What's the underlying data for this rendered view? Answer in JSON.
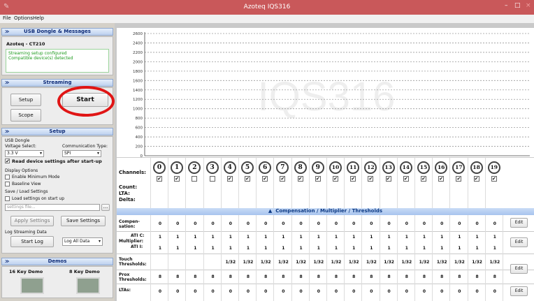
{
  "window": {
    "title": "Azoteq IQS316"
  },
  "menu": [
    "File",
    "Options",
    "Help"
  ],
  "usb_panel": {
    "header": "USB Dongle & Messages",
    "device": "Azoteq - CT210",
    "messages": [
      "Streaming setup configured",
      "Compatible device(s) detected"
    ]
  },
  "streaming_panel": {
    "header": "Streaming",
    "setup": "Setup",
    "start": "Start",
    "scope": "Scope"
  },
  "setup_panel": {
    "header": "Setup",
    "usb_dongle": "USB Dongle",
    "voltage_label": "Voltage Select:",
    "voltage_value": "3.3 V",
    "comm_label": "Communication Type:",
    "comm_value": "SPI",
    "read_settings": "Read device settings after start-up",
    "display_options": "Display Options",
    "enable_minimum": "Enable Minimum Mode",
    "baseline_view": "Baseline View",
    "save_load": "Save / Load Settings",
    "load_on_start": "Load settings on start up",
    "settings_placeholder": "settings file...",
    "browse": "...",
    "apply": "Apply Settings",
    "save": "Save Settings",
    "log_label": "Log Streaming Data",
    "start_log": "Start Log",
    "log_mode": "Log All Data"
  },
  "demos_panel": {
    "header": "Demos",
    "demo1": "16 Key Demo",
    "demo2": "8 Key Demo"
  },
  "chart_data": {
    "type": "line",
    "y_ticks": [
      "2600",
      "2400",
      "2200",
      "2000",
      "1800",
      "1600",
      "1400",
      "1200",
      "1000",
      "800",
      "600",
      "400",
      "200",
      "0"
    ],
    "ylim": [
      0,
      2600
    ],
    "watermark": "IQS316",
    "grid": "dashed horizontal"
  },
  "channels": {
    "label": "Channels:",
    "numbers": [
      "0",
      "1",
      "2",
      "3",
      "4",
      "5",
      "6",
      "7",
      "8",
      "9",
      "10",
      "11",
      "12",
      "13",
      "14",
      "15",
      "16",
      "17",
      "18",
      "19"
    ],
    "checked": [
      true,
      true,
      false,
      false,
      true,
      true,
      true,
      true,
      true,
      true,
      true,
      true,
      true,
      true,
      true,
      true,
      true,
      true,
      true,
      true
    ],
    "count_label": "Count:",
    "lta_label": "LTA:",
    "delta_label": "Delta:"
  },
  "table": {
    "banner": "Compensation / Multiplier / Thresholds",
    "edit": "Edit",
    "compensation_label": "Compen-\nsation:",
    "compensation": [
      "0",
      "0",
      "0",
      "0",
      "0",
      "0",
      "0",
      "0",
      "0",
      "0",
      "0",
      "0",
      "0",
      "0",
      "0",
      "0",
      "0",
      "0",
      "0",
      "0"
    ],
    "multiplier_label": "Multiplier:",
    "ati_c_label": "ATI C:",
    "ati_c": [
      "1",
      "1",
      "1",
      "1",
      "1",
      "1",
      "1",
      "1",
      "1",
      "1",
      "1",
      "1",
      "1",
      "1",
      "1",
      "1",
      "1",
      "1",
      "1",
      "1"
    ],
    "ati_i_label": "ATI I:",
    "ati_i": [
      "1",
      "1",
      "1",
      "1",
      "1",
      "1",
      "1",
      "1",
      "1",
      "1",
      "1",
      "1",
      "1",
      "1",
      "1",
      "1",
      "1",
      "1",
      "1",
      "1"
    ],
    "touch_label": "Touch\nThresholds:",
    "touch": [
      "",
      "",
      "",
      "",
      "1/32",
      "1/32",
      "1/32",
      "1/32",
      "1/32",
      "1/32",
      "1/32",
      "1/32",
      "1/32",
      "1/32",
      "1/32",
      "1/32",
      "1/32",
      "1/32",
      "1/32",
      "1/32"
    ],
    "prox_label": "Prox\nThresholds:",
    "prox": [
      "8",
      "8",
      "8",
      "8",
      "8",
      "8",
      "8",
      "8",
      "8",
      "8",
      "8",
      "8",
      "8",
      "8",
      "8",
      "8",
      "8",
      "8",
      "8",
      "8"
    ],
    "ltas_label": "LTAs:",
    "ltas": [
      "0",
      "0",
      "0",
      "0",
      "0",
      "0",
      "0",
      "0",
      "0",
      "0",
      "0",
      "0",
      "0",
      "0",
      "0",
      "0",
      "0",
      "0",
      "0",
      "0"
    ]
  }
}
